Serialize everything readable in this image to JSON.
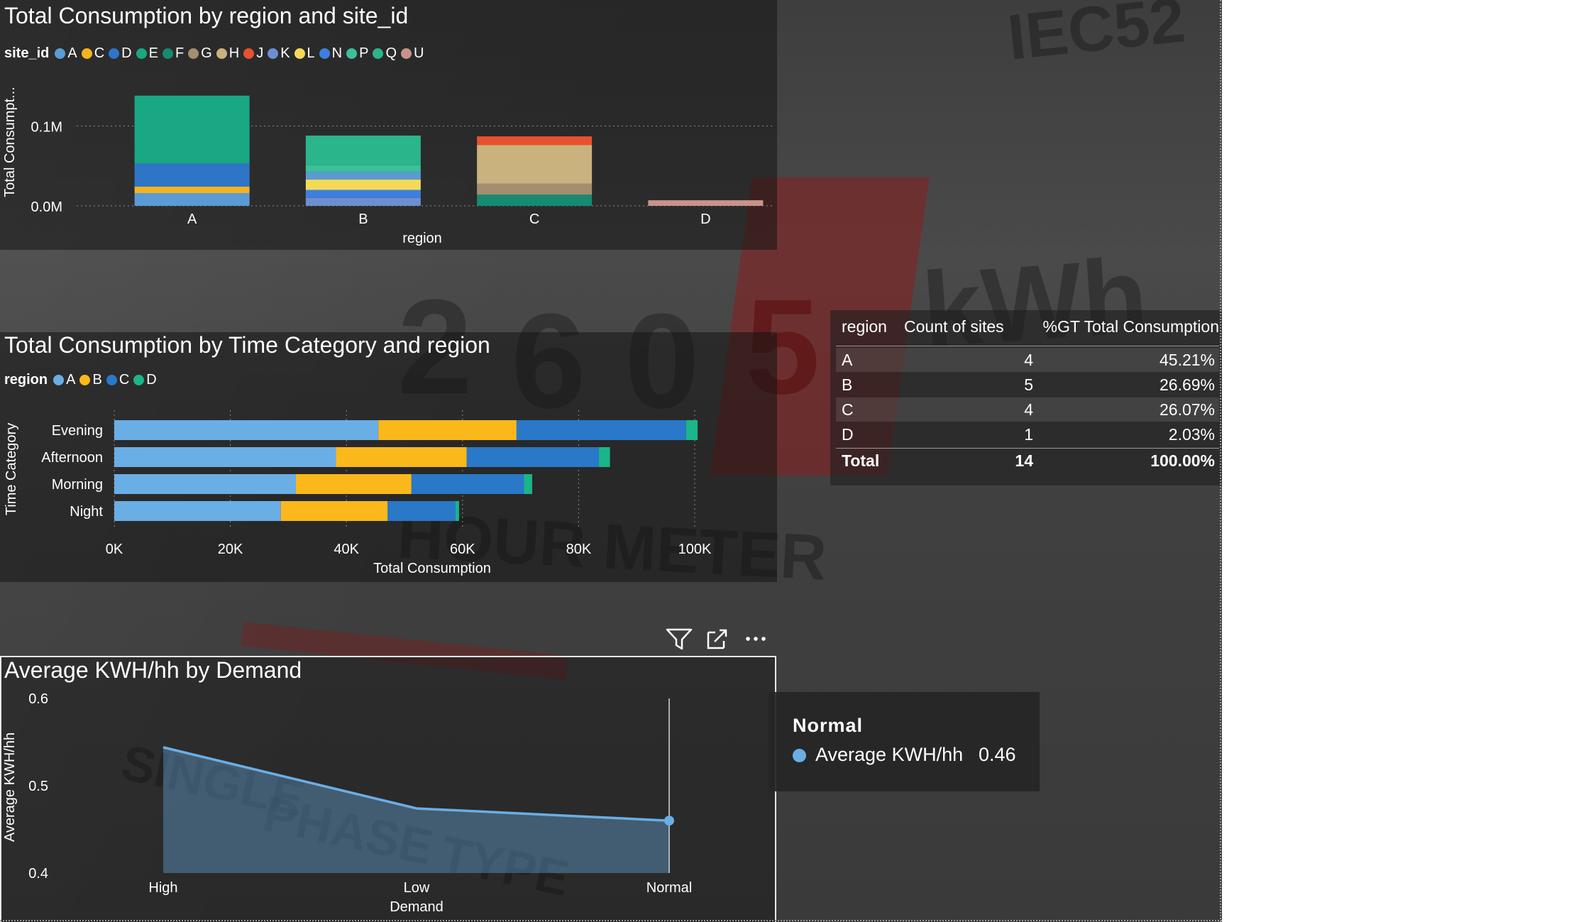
{
  "background": {
    "meter_texts": [
      "IEC52",
      "2",
      "6",
      "0",
      "5",
      "kWh",
      "HOUR METER",
      "SINGLE",
      "PHASE",
      "TYPE"
    ]
  },
  "visual_site": {
    "title": "Total Consumption by region and site_id",
    "legend_title": "site_id",
    "legend": [
      {
        "label": "A",
        "color": "#5b9bd5"
      },
      {
        "label": "C",
        "color": "#f5b31f"
      },
      {
        "label": "D",
        "color": "#2e75c8"
      },
      {
        "label": "E",
        "color": "#1aa784"
      },
      {
        "label": "F",
        "color": "#168a72"
      },
      {
        "label": "G",
        "color": "#a38e6f"
      },
      {
        "label": "H",
        "color": "#c9b27e"
      },
      {
        "label": "J",
        "color": "#e8512d"
      },
      {
        "label": "K",
        "color": "#6d8fd1"
      },
      {
        "label": "L",
        "color": "#f4da56"
      },
      {
        "label": "N",
        "color": "#3d7fe0"
      },
      {
        "label": "P",
        "color": "#3cbf9a"
      },
      {
        "label": "Q",
        "color": "#2ab58a"
      },
      {
        "label": "U",
        "color": "#c9938a"
      }
    ]
  },
  "visual_time": {
    "title": "Total Consumption by Time Category and region",
    "legend_title": "region",
    "legend": [
      {
        "label": "A",
        "color": "#6aaee6"
      },
      {
        "label": "B",
        "color": "#fbb81b"
      },
      {
        "label": "C",
        "color": "#2a78c8"
      },
      {
        "label": "D",
        "color": "#1ab58a"
      }
    ]
  },
  "visual_demand": {
    "title": "Average KWH/hh by Demand",
    "header_icons": [
      "filter-icon",
      "focus-mode-icon",
      "more-options-icon"
    ]
  },
  "table": {
    "headers": [
      "region",
      "Count of sites",
      "%GT Total Consumption"
    ],
    "rows": [
      {
        "region": "A",
        "count": "4",
        "pct": "45.21%"
      },
      {
        "region": "B",
        "count": "5",
        "pct": "26.69%"
      },
      {
        "region": "C",
        "count": "4",
        "pct": "26.07%"
      },
      {
        "region": "D",
        "count": "1",
        "pct": "2.03%"
      }
    ],
    "total": {
      "label": "Total",
      "count": "14",
      "pct": "100.00%"
    }
  },
  "tooltip": {
    "title": "Normal",
    "series_label": "Average KWH/hh",
    "value": "0.46",
    "dot_color": "#6aaee6"
  },
  "chart_data": [
    {
      "type": "bar",
      "stacked": true,
      "title": "Total Consumption by region and site_id",
      "xlabel": "region",
      "ylabel": "Total Consumpt...",
      "categories": [
        "A",
        "B",
        "C",
        "D"
      ],
      "y_ticks": [
        "0.0M",
        "0.1M"
      ],
      "ylim": [
        0,
        0.16
      ],
      "series": [
        {
          "name": "A",
          "color": "#5b9bd5",
          "values": [
            0.016,
            0,
            0,
            0
          ]
        },
        {
          "name": "C",
          "color": "#f5b31f",
          "values": [
            0.008,
            0,
            0,
            0
          ]
        },
        {
          "name": "D",
          "color": "#2e75c8",
          "values": [
            0.029,
            0,
            0,
            0
          ]
        },
        {
          "name": "E",
          "color": "#1aa784",
          "values": [
            0.085,
            0,
            0,
            0
          ]
        },
        {
          "name": "K",
          "color": "#6d8fd1",
          "values": [
            0,
            0.01,
            0,
            0
          ]
        },
        {
          "name": "N",
          "color": "#3d7fe0",
          "values": [
            0,
            0.01,
            0,
            0
          ]
        },
        {
          "name": "L",
          "color": "#f4da56",
          "values": [
            0,
            0.013,
            0,
            0
          ]
        },
        {
          "name": "A",
          "color": "#5b9bd5",
          "values": [
            0,
            0.009,
            0,
            0
          ]
        },
        {
          "name": "P",
          "color": "#3cbf9a",
          "values": [
            0,
            0.009,
            0,
            0
          ]
        },
        {
          "name": "Q",
          "color": "#2ab58a",
          "values": [
            0,
            0.037,
            0,
            0
          ]
        },
        {
          "name": "F",
          "color": "#168a72",
          "values": [
            0,
            0,
            0.014,
            0
          ]
        },
        {
          "name": "G",
          "color": "#a38e6f",
          "values": [
            0,
            0,
            0.014,
            0
          ]
        },
        {
          "name": "H",
          "color": "#c9b27e",
          "values": [
            0,
            0,
            0.048,
            0
          ]
        },
        {
          "name": "J",
          "color": "#e8512d",
          "values": [
            0,
            0,
            0.011,
            0
          ]
        },
        {
          "name": "U",
          "color": "#c9938a",
          "values": [
            0,
            0,
            0,
            0.007
          ]
        }
      ]
    },
    {
      "type": "bar",
      "orientation": "horizontal",
      "stacked": true,
      "title": "Total Consumption by Time Category and region",
      "xlabel": "Total Consumption",
      "ylabel": "Time Category",
      "categories": [
        "Evening",
        "Afternoon",
        "Morning",
        "Night"
      ],
      "x_ticks": [
        "0K",
        "20K",
        "40K",
        "60K",
        "80K",
        "100K"
      ],
      "xlim": [
        0,
        100000
      ],
      "series": [
        {
          "name": "A",
          "color": "#6aaee6",
          "values": [
            45500,
            38200,
            31300,
            28700
          ]
        },
        {
          "name": "B",
          "color": "#fbb81b",
          "values": [
            23800,
            22500,
            19900,
            18400
          ]
        },
        {
          "name": "C",
          "color": "#2a78c8",
          "values": [
            29200,
            22800,
            19400,
            11700
          ]
        },
        {
          "name": "D",
          "color": "#1ab58a",
          "values": [
            2000,
            1900,
            1400,
            600
          ]
        }
      ]
    },
    {
      "type": "area",
      "title": "Average KWH/hh by Demand",
      "xlabel": "Demand",
      "ylabel": "Average KWH/hh",
      "categories": [
        "High",
        "Low",
        "Normal"
      ],
      "y_ticks": [
        "0.4",
        "0.5",
        "0.6"
      ],
      "ylim": [
        0.4,
        0.6
      ],
      "series": [
        {
          "name": "Average KWH/hh",
          "color": "#6aaee6",
          "values": [
            0.544,
            0.474,
            0.46
          ]
        }
      ],
      "highlight": "Normal"
    }
  ]
}
